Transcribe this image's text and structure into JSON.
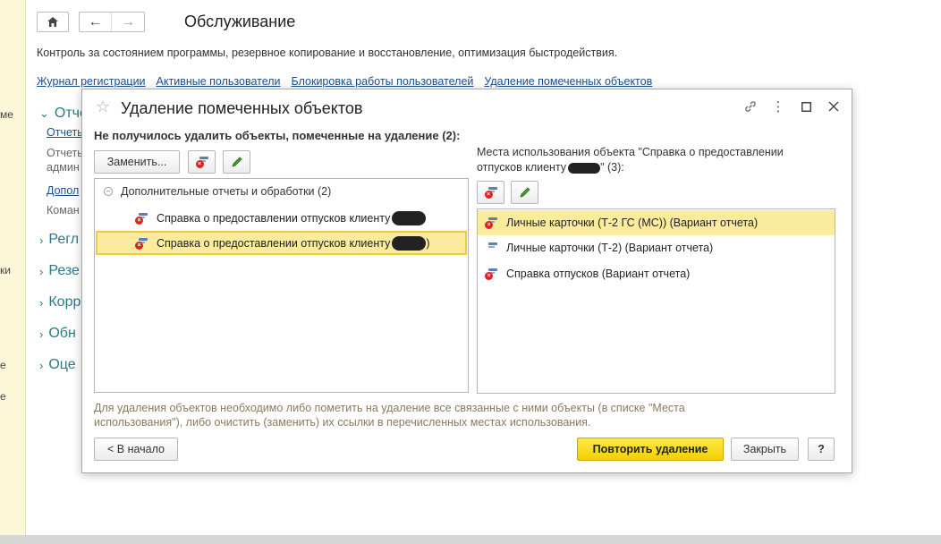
{
  "page": {
    "title": "Обслуживание",
    "description": "Контроль за состоянием программы, резервное копирование и восстановление, оптимизация быстродействия.",
    "links": [
      "Журнал регистрации",
      "Активные пользователи",
      "Блокировка работы пользователей",
      "Удаление помеченных объектов"
    ],
    "sections": [
      {
        "label": "Отче"
      },
      {
        "label": "Регл"
      },
      {
        "label": "Резе"
      },
      {
        "label": "Корр"
      },
      {
        "label": "Обн"
      },
      {
        "label": "Оце"
      }
    ],
    "sub_link_1": "Отчеты",
    "sub_text_1a": "Отчеть",
    "sub_text_1b": "админ",
    "sub_link_2": "Допол",
    "sub_text_2": "Коман",
    "left_strip": [
      "ме",
      "ки",
      "е",
      "е"
    ]
  },
  "dialog": {
    "title": "Удаление помеченных объектов",
    "left_title": "Не получилось удалить объекты, помеченные на удаление (2):",
    "replace_label": "Заменить...",
    "tree_group": "Дополнительные отчеты и обработки (2)",
    "tree_items": [
      {
        "label": "Справка о предоставлении отпусков клиенту",
        "suffix": ""
      },
      {
        "label": "Справка о предоставлении отпусков клиенту",
        "suffix": ")"
      }
    ],
    "right_title": "Места использования объекта \"Справка о предоставлении отпусков клиенту",
    "right_title_suffix": "\" (3):",
    "usage_items": [
      {
        "label": "Личные карточки (Т-2 ГС (МС)) (Вариант отчета)"
      },
      {
        "label": "Личные карточки (Т-2) (Вариант отчета)"
      },
      {
        "label": "Справка отпусков (Вариант отчета)"
      }
    ],
    "hint": "Для удаления объектов необходимо либо пометить на удаление все связанные с ними объекты (в списке \"Места использования\"), либо очистить (заменить) их ссылки в перечисленных местах использования.",
    "back_label": "< В начало",
    "retry_label": "Повторить удаление",
    "close_label": "Закрыть",
    "help_label": "?"
  }
}
